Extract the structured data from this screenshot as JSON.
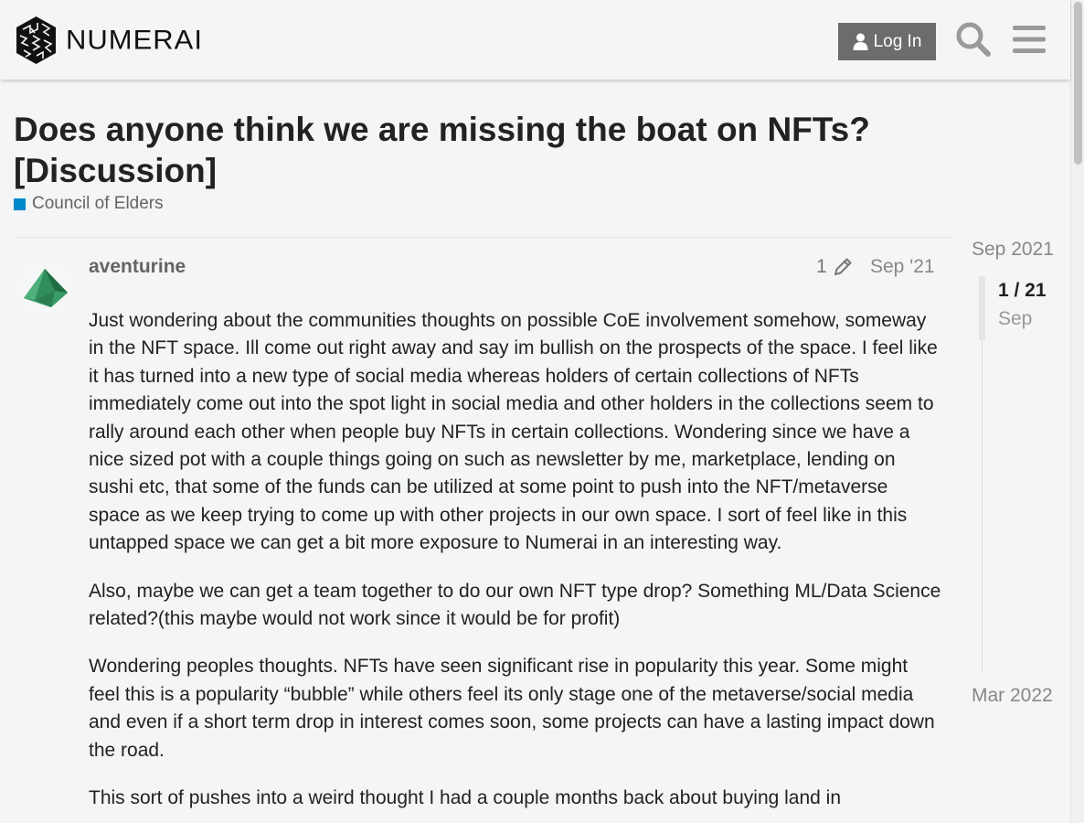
{
  "header": {
    "brand": "NUMERAI",
    "login_label": "Log In",
    "icons": [
      "user-icon",
      "search-icon",
      "hamburger-menu-icon"
    ]
  },
  "topic": {
    "title": "Does anyone think we are missing the boat on NFTs? [Discussion]",
    "category": "Council of Elders",
    "category_color": "#0088cc"
  },
  "post": {
    "username": "aventurine",
    "edit_count": "1",
    "date": "Sep '21",
    "paragraphs": [
      "Just wondering about the communities thoughts on possible CoE involvement somehow, someway in the NFT space. Ill come out right away and say im bullish on the prospects of the space. I feel like it has turned into a new type of social media whereas holders of certain collections of NFTs immediately come out into the spot light in social media and other holders in the collections seem to rally around each other when people buy NFTs in certain collections. Wondering since we have a nice sized pot with a couple things going on such as newsletter by me, marketplace, lending on sushi etc, that some of the funds can be utilized at some point to push into the NFT/metaverse space as we keep trying to come up with other projects in our own space. I sort of feel like in this untapped space we can get a bit more exposure to Numerai in an interesting way.",
      "Also, maybe we can get a team together to do our own NFT type drop? Something ML/Data Science related?(this maybe would not work since it would be for profit)",
      "Wondering peoples thoughts. NFTs have seen significant rise in popularity this year. Some might feel this is a popularity “bubble” while others feel its only stage one of the metaverse/social media and even if a short term drop in interest comes soon, some projects can have a lasting impact down the road.",
      "This sort of pushes into a weird thought I had a couple months back about buying land in"
    ]
  },
  "timeline": {
    "start": "Sep 2021",
    "position": "1 / 21",
    "current_date": "Sep",
    "end": "Mar 2022"
  }
}
